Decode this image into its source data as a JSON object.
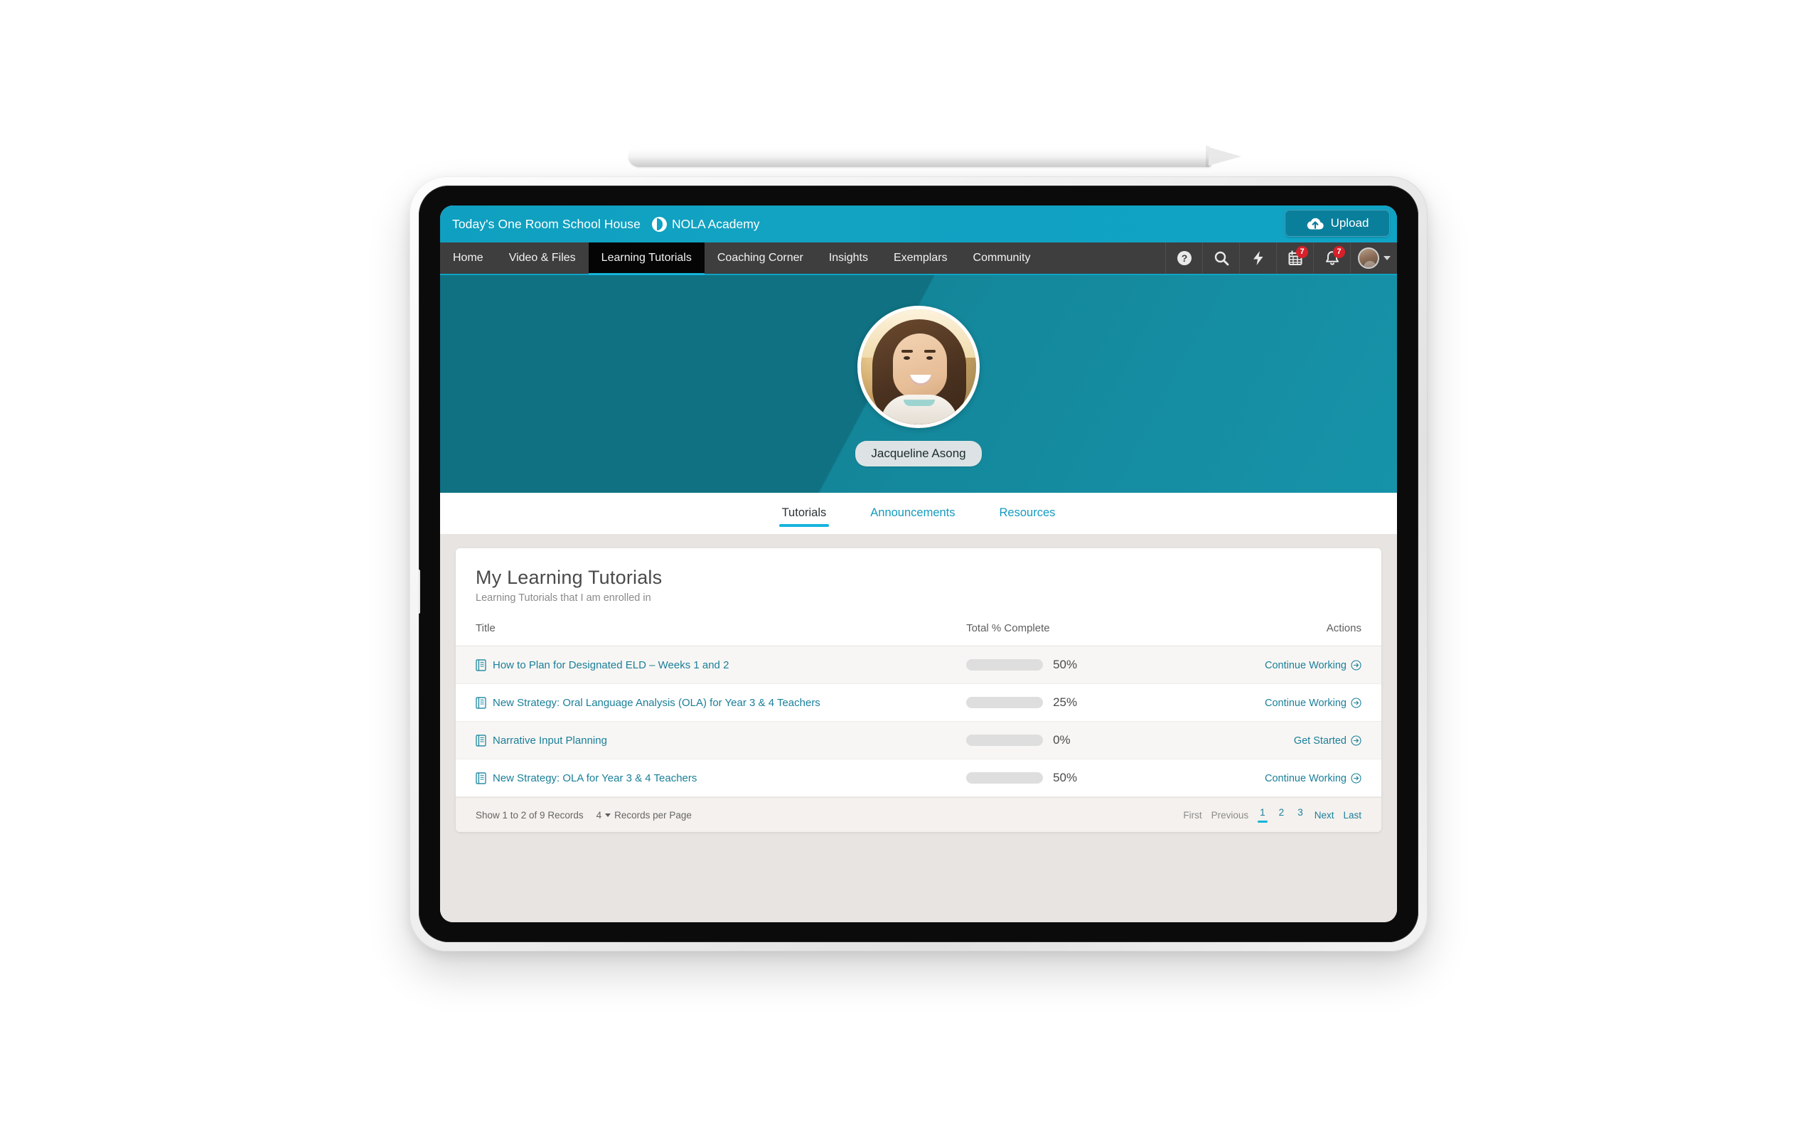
{
  "app": {
    "topbar": {
      "title": "Today's One Room School House",
      "brand_name": "NOLA Academy",
      "brand_icon": "split-circle-logo-icon",
      "upload_label": "Upload",
      "upload_icon": "cloud-upload-icon"
    },
    "nav": {
      "items": [
        {
          "label": "Home",
          "active": false
        },
        {
          "label": "Video & Files",
          "active": false
        },
        {
          "label": "Learning Tutorials",
          "active": true
        },
        {
          "label": "Coaching Corner",
          "active": false
        },
        {
          "label": "Insights",
          "active": false
        },
        {
          "label": "Exemplars",
          "active": false
        },
        {
          "label": "Community",
          "active": false
        }
      ],
      "icons": [
        {
          "name": "help-icon",
          "badge": ""
        },
        {
          "name": "search-icon",
          "badge": ""
        },
        {
          "name": "lightning-icon",
          "badge": ""
        },
        {
          "name": "calendar-icon",
          "badge": "7"
        },
        {
          "name": "bell-icon",
          "badge": "7"
        }
      ],
      "avatar_name": "user-avatar"
    },
    "hero": {
      "user_name": "Jacqueline Asong",
      "avatar_alt": "profile-photo"
    },
    "subtabs": [
      {
        "label": "Tutorials",
        "active": true
      },
      {
        "label": "Announcements",
        "active": false
      },
      {
        "label": "Resources",
        "active": false
      }
    ],
    "card": {
      "title": "My Learning Tutorials",
      "subtitle": "Learning Tutorials that I am enrolled in",
      "columns": {
        "title": "Title",
        "progress": "Total % Complete",
        "actions": "Actions"
      },
      "rows": [
        {
          "title": "How to Plan for Designated ELD – Weeks 1 and 2",
          "percent": 50,
          "percent_label": "50%",
          "action": "Continue Working"
        },
        {
          "title": "New Strategy: Oral Language Analysis (OLA) for Year 3 & 4 Teachers",
          "percent": 25,
          "percent_label": "25%",
          "action": "Continue Working"
        },
        {
          "title": "Narrative Input Planning",
          "percent": 0,
          "percent_label": "0%",
          "action": "Get Started"
        },
        {
          "title": "New Strategy: OLA for Year 3 & 4 Teachers",
          "percent": 50,
          "percent_label": "50%",
          "action": "Continue Working"
        }
      ],
      "footer": {
        "records_text": "Show 1 to 2 of 9 Records",
        "records_per_page_value": "4",
        "records_per_page_label": "Records per Page",
        "first": "First",
        "previous": "Previous",
        "pages": [
          "1",
          "2",
          "3"
        ],
        "active_page": "1",
        "next": "Next",
        "last": "Last"
      }
    }
  },
  "colors": {
    "topbar_cyan": "#0fa3c4",
    "nav_dark": "#3e3e3e",
    "hero_teal": "#0f7182",
    "accent_teal": "#0d9dbc",
    "link_teal": "#1a7f99",
    "badge_red": "#d8202a",
    "page_bg": "#e8e4e1"
  }
}
